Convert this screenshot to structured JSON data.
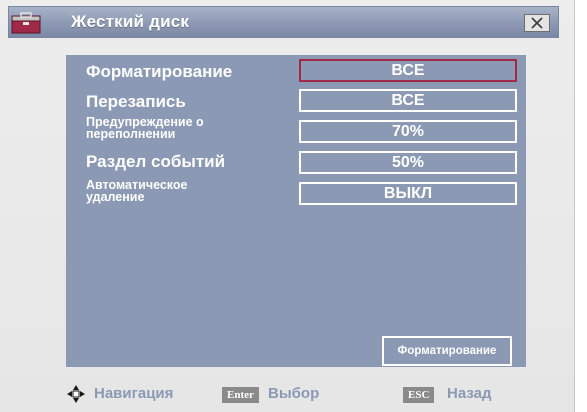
{
  "window": {
    "title": "Жесткий диск"
  },
  "settings": [
    {
      "label": "Форматирование",
      "value": "ВСЕ"
    },
    {
      "label": "Перезапись",
      "value": "ВСЕ"
    },
    {
      "label": "Предупреждение о переполнении",
      "value": "70%"
    },
    {
      "label": "Раздел событий",
      "value": "50%"
    },
    {
      "label": "Автоматическое удаление",
      "value": "ВЫКЛ"
    }
  ],
  "format_button": {
    "label": "Форматирование"
  },
  "footer": {
    "nav_label": "Навигация",
    "enter_key": "Enter",
    "enter_label": "Выбор",
    "esc_key": "ESC",
    "esc_label": "Назад"
  },
  "colors": {
    "panel": "#8b99b4",
    "titlebar": "#8d99b3",
    "active_border": "#9e2a48",
    "hint_text": "#8b99b4"
  }
}
